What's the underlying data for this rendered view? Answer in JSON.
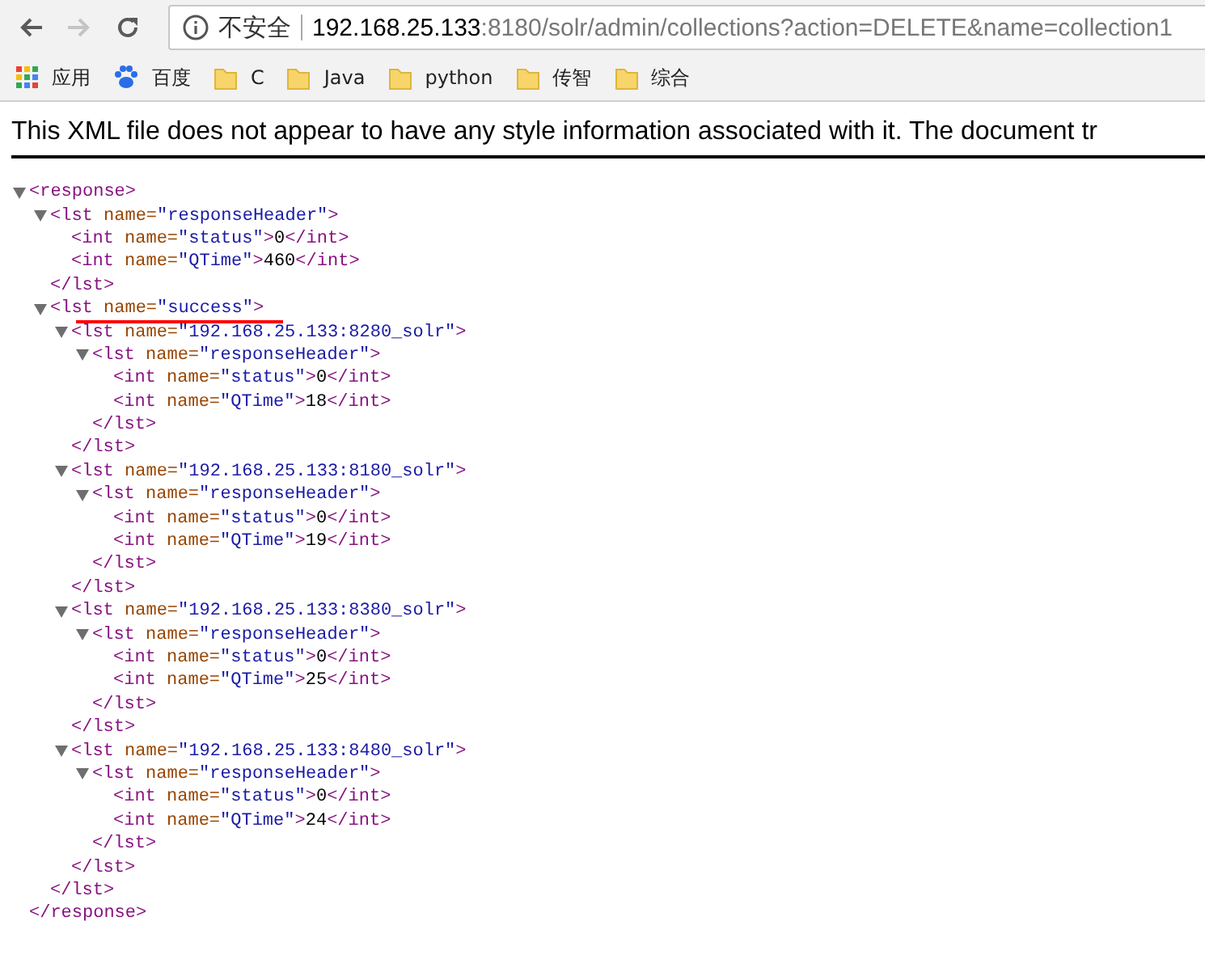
{
  "nav_buttons": [
    {
      "kind": "back",
      "disabled": false
    },
    {
      "kind": "forward",
      "disabled": true
    },
    {
      "kind": "reload",
      "disabled": false
    }
  ],
  "address_bar": {
    "security": "不安全",
    "host": "192.168.25.133",
    "path": ":8180/solr/admin/collections?action=DELETE&name=collection1"
  },
  "bookmarks": [
    {
      "kind": "apps",
      "label": "应用"
    },
    {
      "kind": "site",
      "label": "百度"
    },
    {
      "kind": "folder",
      "label": "C"
    },
    {
      "kind": "folder",
      "label": "Java"
    },
    {
      "kind": "folder",
      "label": "python"
    },
    {
      "kind": "folder",
      "label": "传智"
    },
    {
      "kind": "folder",
      "label": "综合"
    }
  ],
  "notice": "This XML file does not appear to have any style information associated with it. The document tr",
  "xml_tree": [
    {
      "open": "<response>",
      "close": "</response>",
      "expanded": true,
      "children": [
        {
          "open": "<lst name=\"responseHeader\">",
          "close": "</lst>",
          "expanded": true,
          "children": [
            {
              "line": "<int name=\"status\">0</int>"
            },
            {
              "line": "<int name=\"QTime\">460</int>"
            }
          ]
        },
        {
          "open": "<lst name=\"success\">",
          "close": "</lst>",
          "expanded": true,
          "underlined": true,
          "children": [
            {
              "open": "<lst name=\"192.168.25.133:8280_solr\">",
              "close": "</lst>",
              "expanded": true,
              "children": [
                {
                  "open": "<lst name=\"responseHeader\">",
                  "close": "</lst>",
                  "expanded": true,
                  "children": [
                    {
                      "line": "<int name=\"status\">0</int>"
                    },
                    {
                      "line": "<int name=\"QTime\">18</int>"
                    }
                  ]
                }
              ]
            },
            {
              "open": "<lst name=\"192.168.25.133:8180_solr\">",
              "close": "</lst>",
              "expanded": true,
              "children": [
                {
                  "open": "<lst name=\"responseHeader\">",
                  "close": "</lst>",
                  "expanded": true,
                  "children": [
                    {
                      "line": "<int name=\"status\">0</int>"
                    },
                    {
                      "line": "<int name=\"QTime\">19</int>"
                    }
                  ]
                }
              ]
            },
            {
              "open": "<lst name=\"192.168.25.133:8380_solr\">",
              "close": "</lst>",
              "expanded": true,
              "children": [
                {
                  "open": "<lst name=\"responseHeader\">",
                  "close": "</lst>",
                  "expanded": true,
                  "children": [
                    {
                      "line": "<int name=\"status\">0</int>"
                    },
                    {
                      "line": "<int name=\"QTime\">25</int>"
                    }
                  ]
                }
              ]
            },
            {
              "open": "<lst name=\"192.168.25.133:8480_solr\">",
              "close": "</lst>",
              "expanded": true,
              "children": [
                {
                  "open": "<lst name=\"responseHeader\">",
                  "close": "</lst>",
                  "expanded": true,
                  "children": [
                    {
                      "line": "<int name=\"status\">0</int>"
                    },
                    {
                      "line": "<int name=\"QTime\">24</int>"
                    }
                  ]
                }
              ]
            }
          ]
        }
      ]
    }
  ]
}
